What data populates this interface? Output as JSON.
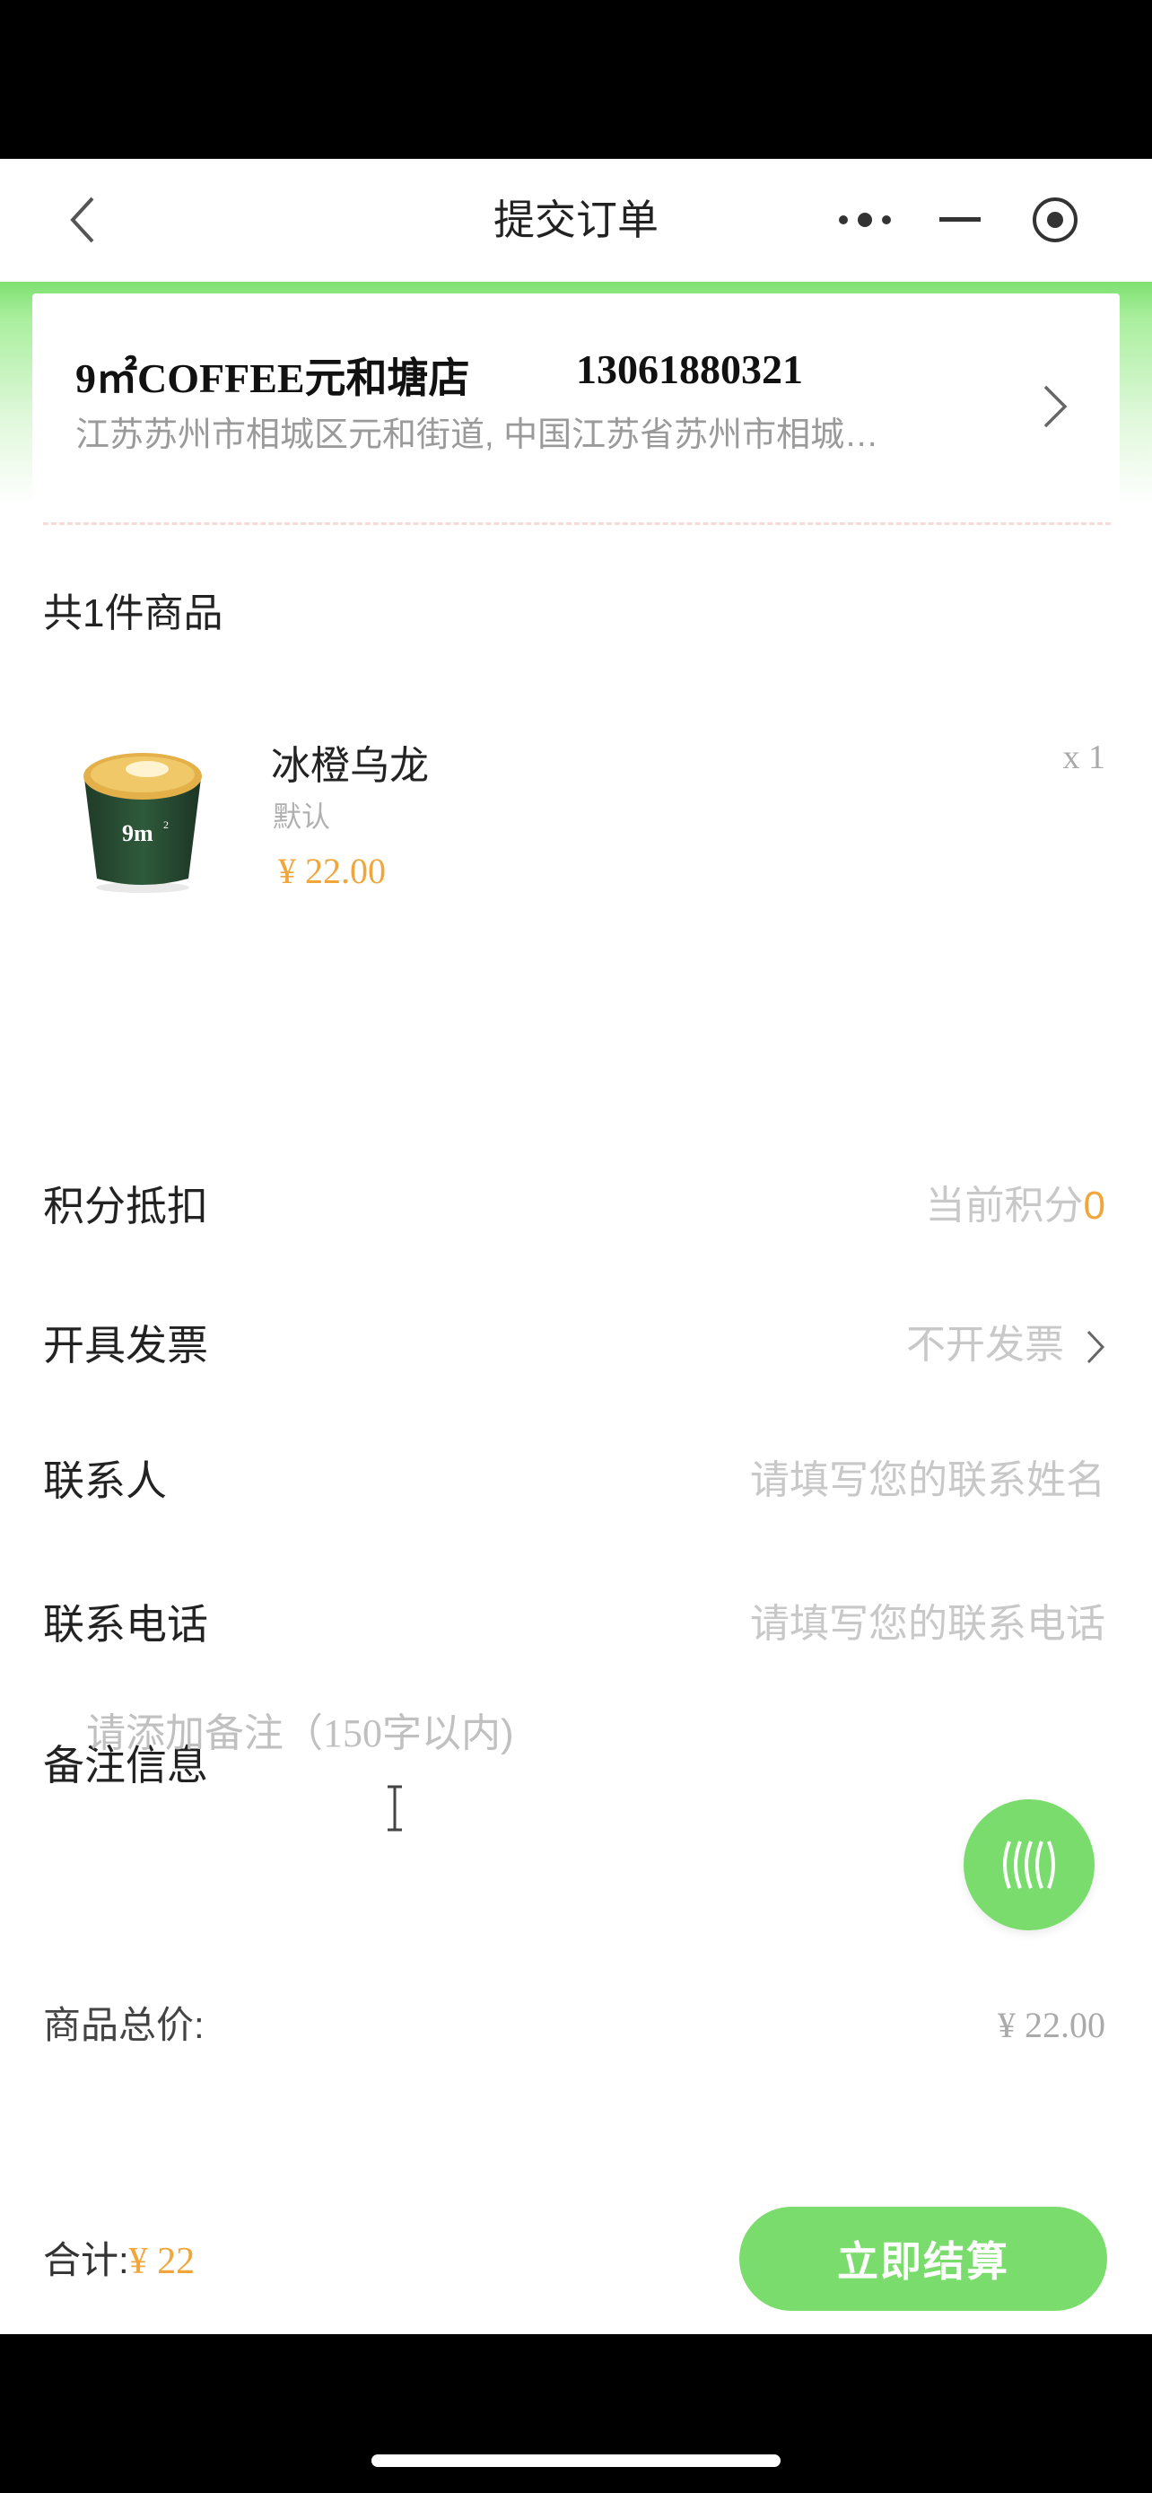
{
  "nav": {
    "title": "提交订单"
  },
  "store": {
    "name": "9㎡COFFEE元和塘店",
    "phone": "13061880321",
    "address": "江苏苏州市相城区元和街道, 中国江苏省苏州市相城…"
  },
  "order": {
    "count_label": "共1件商品",
    "items": [
      {
        "name": "冰橙乌龙",
        "spec": "默认",
        "price": "¥ 22.00",
        "qty": "x 1"
      }
    ]
  },
  "points": {
    "label": "积分抵扣",
    "current_prefix": "当前积分",
    "current_value": "0"
  },
  "invoice": {
    "label": "开具发票",
    "value": "不开发票"
  },
  "contact": {
    "label": "联系人",
    "placeholder": "请填写您的联系姓名"
  },
  "phone_field": {
    "label": "联系电话",
    "placeholder": "请填写您的联系电话"
  },
  "remark": {
    "label": "备注信息",
    "placeholder_a": "请添加备注（",
    "placeholder_num": "150",
    "placeholder_b": "字以内)"
  },
  "summary": {
    "goods_total_label": "商品总价:",
    "goods_total_value": "¥ 22.00"
  },
  "footer": {
    "sum_label": "合计:",
    "sum_value": "¥ 22",
    "pay_button": "立即结算"
  },
  "colors": {
    "accent_green": "#7bdc6e",
    "price_orange": "#f0a63b"
  },
  "icons": {
    "back": "chevron-left-icon",
    "more": "more-dots-icon",
    "minimize": "minus-icon",
    "close": "target-circle-icon",
    "store_arrow": "chevron-right-icon",
    "float": "wave-lines-icon"
  }
}
